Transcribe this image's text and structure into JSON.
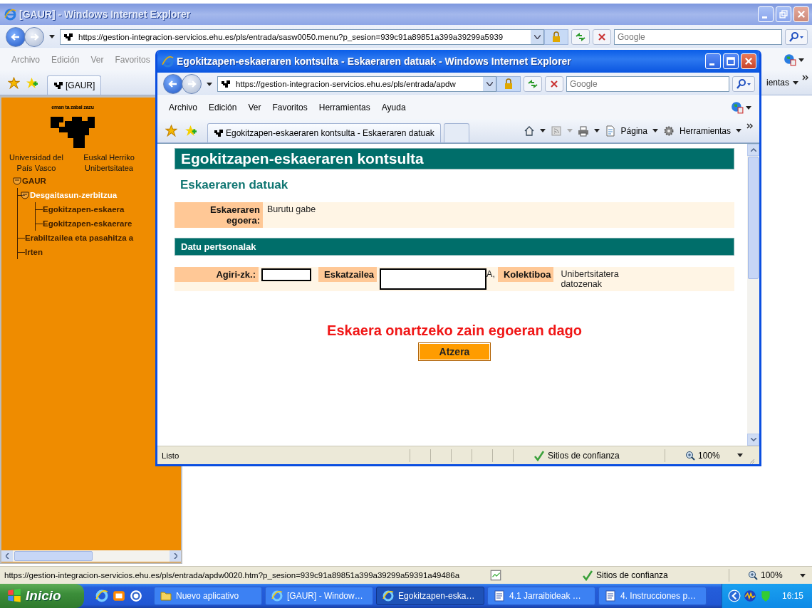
{
  "back_window": {
    "title": "[GAUR] - Windows Internet Explorer",
    "address": "https://gestion-integracion-servicios.ehu.es/pls/entrada/sasw0050.menu?p_sesion=939c91a89851a399a39299a5939",
    "search_placeholder": "Google",
    "menu": [
      "Archivo",
      "Edición",
      "Ver",
      "Favoritos"
    ],
    "tools_fragment": "ientas",
    "tabs": [
      {
        "label": "[GAUR]",
        "selected": true
      }
    ],
    "sidebar": {
      "motto": "eman ta zabal zazu",
      "university_es": "Universidad del País Vasco",
      "university_eu": "Euskal Herriko Unibertsitatea",
      "tree": [
        {
          "label": "GAUR",
          "expanded": true,
          "selected": false,
          "children": [
            {
              "label": "Desgaitasun-zerbitzua",
              "expanded": true,
              "selected": true,
              "children": [
                {
                  "label": "Egokitzapen-eskaera",
                  "selected": false
                },
                {
                  "label": "Egokitzapen-eskaerare",
                  "selected": false
                }
              ]
            },
            {
              "label": "Erabiltzailea eta pasahitza a",
              "selected": false
            },
            {
              "label": "Irten",
              "selected": false
            }
          ]
        }
      ]
    },
    "status_url": "https://gestion-integracion-servicios.ehu.es/pls/entrada/apdw0020.htm?p_sesion=939c91a89851a399a39299a59391a49486a",
    "zone": "Sitios de confianza",
    "zoom": "100%"
  },
  "popup": {
    "title": "Egokitzapen-eskaeraren kontsulta - Eskaeraren datuak - Windows Internet Explorer",
    "address": "https://gestion-integracion-servicios.ehu.es/pls/entrada/apdw",
    "search_placeholder": "Google",
    "menu": [
      "Archivo",
      "Edición",
      "Ver",
      "Favoritos",
      "Herramientas",
      "Ayuda"
    ],
    "tabs": [
      {
        "label": "Egokitzapen-eskaeraren kontsulta - Eskaeraren datuak",
        "selected": true
      }
    ],
    "command_bar": [
      "Página",
      "Herramientas"
    ],
    "page": {
      "heading": "Egokitzapen-eskaeraren kontsulta",
      "subheading": "Eskaeraren datuak",
      "state_label": "Eskaeraren egoera:",
      "state_value": "Burutu gabe",
      "section": "Datu pertsonalak",
      "fields": [
        {
          "label": "Agiri-zk.:",
          "kind": "redacted"
        },
        {
          "label": "Eskatzailea",
          "kind": "redacted",
          "suffix": "A,"
        },
        {
          "label": "Kolektiboa",
          "kind": "text",
          "value": "Unibertsitatera datozenak"
        }
      ],
      "message": "Eskaera onartzeko zain egoeran dago",
      "button": "Atzera"
    },
    "status": "Listo",
    "zone": "Sitios de confianza",
    "zoom": "100%"
  },
  "taskbar": {
    "start": "Inicio",
    "tasks": [
      {
        "label": "Nuevo aplicativo",
        "kind": "folder",
        "selected": false
      },
      {
        "label": "[GAUR] - Window…",
        "kind": "browser",
        "selected": false
      },
      {
        "label": "Egokitzapen-eska…",
        "kind": "browser",
        "selected": true
      },
      {
        "label": "4.1 Jarraibideak …",
        "kind": "document",
        "selected": false
      },
      {
        "label": "4. Instrucciones p…",
        "kind": "document",
        "selected": false
      }
    ],
    "clock": "16:15"
  }
}
